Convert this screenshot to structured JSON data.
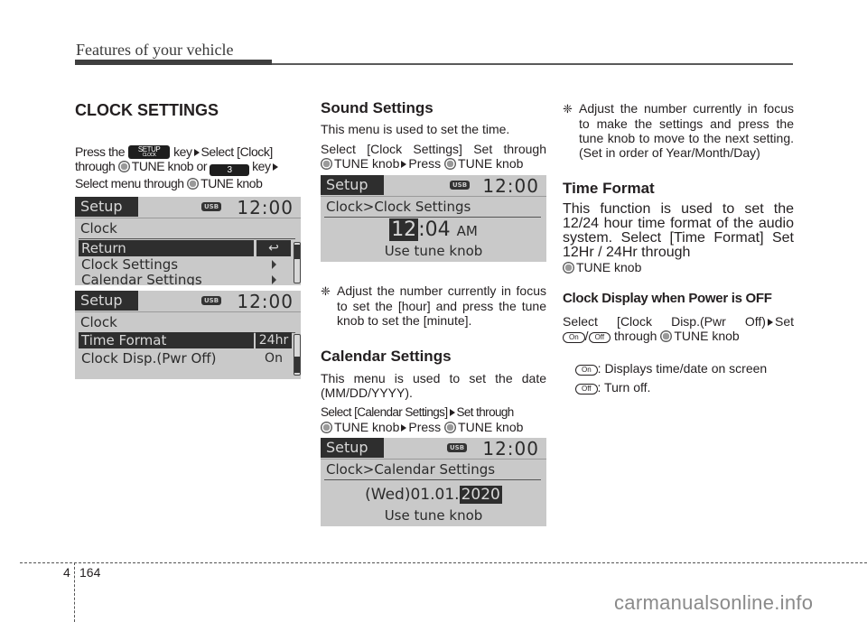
{
  "header": {
    "running_title": "Features of your vehicle"
  },
  "col1": {
    "title": "CLOCK SETTINGS",
    "intro": {
      "t1": "Press the",
      "setup_key": "SETUP",
      "setup_key_sub": "CLOCK",
      "t2": "key",
      "t3": "Select [Clock]",
      "t4": "through",
      "t5": "TUNE knob or",
      "num_key": "3",
      "t6": "key",
      "t7": "Select menu through",
      "t8": "TUNE knob"
    },
    "screen1": {
      "tab": "Setup",
      "usb": "USB",
      "time": "12:00",
      "title": "Clock",
      "rows": [
        {
          "label": "Return",
          "selected": true,
          "side": "return-icon"
        },
        {
          "label": "Clock Settings",
          "selected": false,
          "side": "arrow"
        },
        {
          "label": "Calendar Settings",
          "selected": false,
          "side": "arrow"
        }
      ],
      "return_glyph": "↩"
    },
    "screen2": {
      "tab": "Setup",
      "usb": "USB",
      "time": "12:00",
      "title": "Clock",
      "rows": [
        {
          "label": "Time Format",
          "selected": true,
          "value": "24hr"
        },
        {
          "label": "Clock Disp.(Pwr Off)",
          "selected": false,
          "value": "On"
        }
      ]
    }
  },
  "col2": {
    "sound": {
      "title": "Sound Settings",
      "desc": "This menu is used to set the time.",
      "l1": "Select [Clock Settings] Set through",
      "l2a": "TUNE knob",
      "l2b": "Press",
      "l2c": "TUNE knob"
    },
    "screen3": {
      "tab": "Setup",
      "usb": "USB",
      "time": "12:00",
      "title": "Clock>Clock Settings",
      "hour": "12",
      "sep": ":",
      "minute": "04",
      "ampm": "AM",
      "hint": "Use tune knob"
    },
    "note1": {
      "symbol": "❈",
      "text": "Adjust the number currently in focus to set the [hour] and press the tune knob to set the [minute]."
    },
    "calendar": {
      "title": "Calendar Settings",
      "desc": "This menu is used to set the date (MM/DD/YYYY).",
      "l1a": "Select [Calendar Settings]",
      "l1b": "Set through",
      "l2a": "TUNE knob",
      "l2b": "Press",
      "l2c": "TUNE knob"
    },
    "screen4": {
      "tab": "Setup",
      "usb": "USB",
      "time": "12:00",
      "title": "Clock>Calendar Settings",
      "date_prefix": "(Wed)01.01.",
      "year": "2020",
      "hint": "Use tune knob"
    }
  },
  "col3": {
    "note2": {
      "symbol": "❈",
      "text": "Adjust the number currently in focus to make the settings and press the tune knob to move to the next setting. (Set in order of Year/Month/Day)"
    },
    "time_format": {
      "title": "Time Format",
      "desc": "This function is used to set the 12/24 hour time format of the audio system. Select [Time Format] Set 12Hr / 24Hr through",
      "tune": "TUNE knob"
    },
    "clock_display": {
      "title": "Clock Display when Power is OFF",
      "l1a": "Select [Clock Disp.(Pwr Off)",
      "l1b": "Set",
      "on": "On",
      "slash": "/",
      "off": "Off",
      "l2": "through",
      "tune": "TUNE knob",
      "on_desc": ": Displays time/date on screen",
      "off_desc": ": Turn off."
    }
  },
  "footer": {
    "chapter": "4",
    "page": "164",
    "watermark": "carmanualsonline.info"
  }
}
